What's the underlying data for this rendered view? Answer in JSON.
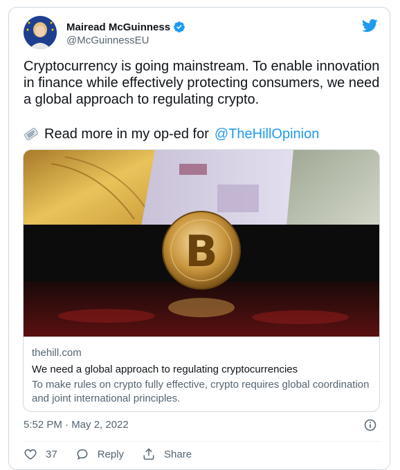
{
  "author": {
    "name": "Mairead McGuinness",
    "handle": "@McGuinnessEU"
  },
  "tweet": {
    "text": "Cryptocurrency is going mainstream. To enable innovation in finance while effectively protecting consumers, we need a global approach to regulating crypto.",
    "readmore_prefix": "Read more in my op-ed for",
    "mention": "@TheHillOpinion",
    "timestamp": "5:52 PM · May 2, 2022"
  },
  "card": {
    "domain": "thehill.com",
    "title": "We need a global approach to regulating cryptocurrencies",
    "description": "To make rules on crypto fully effective, crypto requires global coordination and joint international principles."
  },
  "actions": {
    "like_count": "37",
    "reply_label": "Reply",
    "share_label": "Share"
  },
  "colors": {
    "accent": "#1d9bf0",
    "text": "#0f1419",
    "secondary": "#536471"
  }
}
